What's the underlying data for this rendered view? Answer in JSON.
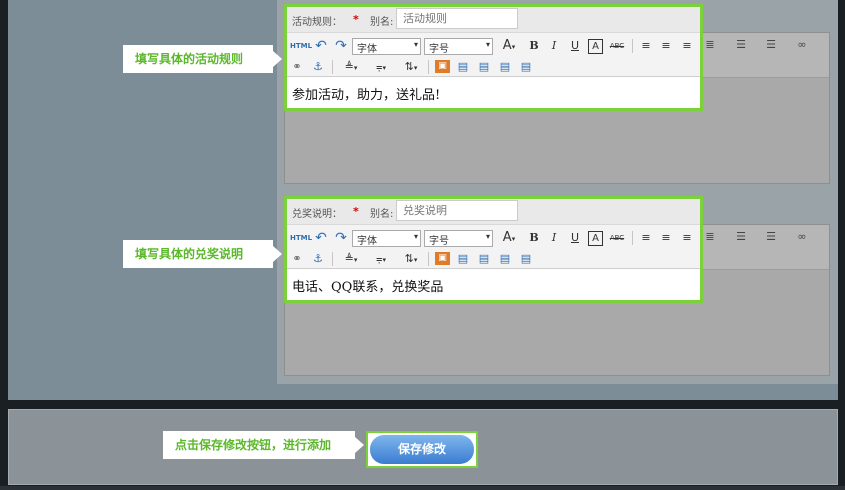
{
  "editors": [
    {
      "label": "活动规则：",
      "required_mark": "*",
      "alias_label": "别名:",
      "alias_placeholder": "活动规则",
      "content": "参加活动，助力，送礼品!",
      "callout": "填写具体的活动规则"
    },
    {
      "label": "兑奖说明：",
      "required_mark": "*",
      "alias_label": "别名:",
      "alias_placeholder": "兑奖说明",
      "content": "电话、QQ联系，兑换奖品",
      "callout": "填写具体的兑奖说明"
    }
  ],
  "toolbar": {
    "html_label": "HTML",
    "undo_icon": "↶",
    "redo_icon": "↷",
    "font_family_placeholder": "字体",
    "font_size_placeholder": "字号",
    "font_color_icon": "A",
    "bold": "B",
    "italic": "I",
    "underline": "U",
    "box_a": "A",
    "strike": "ABC",
    "align_left_icon": "≡",
    "align_center_icon": "≡",
    "align_right_icon": "≡",
    "justify_icon": "≣",
    "ordered_list_icon": "☰",
    "unordered_list_icon": "☰",
    "link_icon": "∞",
    "unlink_icon": "⚭",
    "anchor_icon": "⚓",
    "line_height_icon": "≜",
    "para_spacing_icon": "⩦",
    "font_size_adjust_icon": "⇅",
    "image_icon": "▣",
    "layout_icon": "▤",
    "dropdown_arrow": "▾"
  },
  "save": {
    "callout": "点击保存修改按钮，进行添加",
    "button_label": "保存修改"
  },
  "colors": {
    "highlight": "#7bd13a",
    "callout_text": "#5cb82b",
    "button_top": "#7fb6ee",
    "button_bottom": "#3a7cd0"
  }
}
